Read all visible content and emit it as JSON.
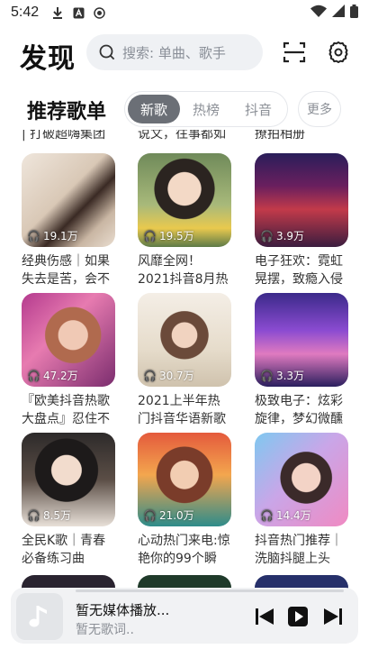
{
  "status_bar": {
    "time": "5:42",
    "icons": [
      "download-icon",
      "a-icon",
      "record-icon",
      "wifi-icon",
      "signal-icon",
      "battery-icon"
    ]
  },
  "header": {
    "title": "发现",
    "search_placeholder": "搜索: 单曲、歌手"
  },
  "section": {
    "title": "推荐歌单",
    "tabs": [
      {
        "label": "新歌",
        "active": true
      },
      {
        "label": "热榜",
        "active": false
      },
      {
        "label": "抖音",
        "active": false
      }
    ],
    "more_label": "更多"
  },
  "partial_row": [
    "| 打破超嗨集团",
    "说文，往事都如",
    "撩拍相册"
  ],
  "playlists": [
    {
      "plays": "19.1万",
      "name": "经典伤感｜如果失去是苦，会不"
    },
    {
      "plays": "19.5万",
      "name": "风靡全网！2021抖音8月热歌盘点"
    },
    {
      "plays": "3.9万",
      "name": "电子狂欢：霓虹晃摆，致瘾入侵"
    },
    {
      "plays": "47.2万",
      "name": "『欧美抖音热歌大盘点』忍住不"
    },
    {
      "plays": "30.7万",
      "name": "2021上半年热门抖音华语新歌锦"
    },
    {
      "plays": "3.3万",
      "name": "极致电子：炫彩旋律，梦幻微醺"
    },
    {
      "plays": "8.5万",
      "name": "全民K歌｜青春必备练习曲"
    },
    {
      "plays": "21.0万",
      "name": "心动热门来电:惊艳你的99个瞬"
    },
    {
      "plays": "14.4万",
      "name": "抖音热门推荐｜洗脑抖腿上头"
    }
  ],
  "player": {
    "title": "暂无媒体播放...",
    "lyric": "暂无歌词.."
  },
  "colors": {
    "tab_active_bg": "#6b6f76",
    "search_bg": "#eff1f4",
    "player_bg": "#f1f2f4"
  }
}
